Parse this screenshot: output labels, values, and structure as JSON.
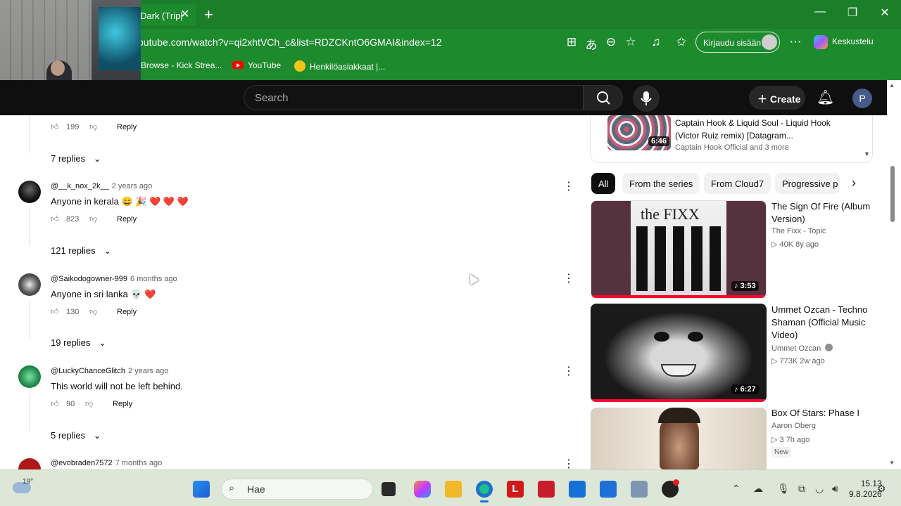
{
  "browser": {
    "tab_title": "Dark (Trip|",
    "url": "outube.com/watch?v=qi2xhtVCh_c&list=RDZCKntO6GMAI&index=12",
    "login_label": "Kirjaudu sisään",
    "copilot_label": "Keskustelu",
    "bookmarks": [
      {
        "label": "Browse - Kick Strea..."
      },
      {
        "label": "YouTube"
      },
      {
        "label": "Henkilöasiakkaat |..."
      }
    ]
  },
  "youtube": {
    "search_placeholder": "Search",
    "create_label": "Create",
    "profile_initial": "P"
  },
  "comments": {
    "first_actions": {
      "likes": "199",
      "reply": "Reply"
    },
    "first_replies": "7 replies",
    "items": [
      {
        "author": "@__k_nox_2k__",
        "time": "2 years ago",
        "text": "Anyone in kerala 😄 🎉 ❤️ ❤️ ❤️",
        "likes": "823",
        "reply": "Reply",
        "replies": "121 replies"
      },
      {
        "author": "@Saikodogowner-999",
        "time": "6 months ago",
        "text": "Anyone in sri lanka 💀 ❤️",
        "likes": "130",
        "reply": "Reply",
        "replies": "19 replies"
      },
      {
        "author": "@LuckyChanceGlitch",
        "time": "2 years ago",
        "text": "This world will not be left behind.",
        "likes": "90",
        "reply": "Reply",
        "replies": "5 replies"
      },
      {
        "author": "@evobraden7572",
        "time": "7 months ago"
      }
    ]
  },
  "playlist_item": {
    "title": "Captain Hook & Liquid Soul - Liquid Hook (Victor Ruiz remix) [Datagram...",
    "channel": "Captain Hook Official and 3 more",
    "duration": "6:46"
  },
  "chips": [
    "All",
    "From the series",
    "From Cloud7",
    "Progressive p"
  ],
  "recommendations": [
    {
      "title": "The Sign Of Fire (Album Version)",
      "channel": "The Fixx - Topic",
      "meta": "40K  8y ago",
      "duration": "3:53",
      "thumb_text": "the FIXX"
    },
    {
      "title": "Ummet Ozcan - Techno Shaman (Official Music Video)",
      "channel": "Ummet Ozcan",
      "meta": "773K  2w ago",
      "duration": "6:27"
    },
    {
      "title": "Box Of Stars: Phase I",
      "channel": "Aaron Oberg",
      "meta": "3  7h ago",
      "badge": "New"
    }
  ],
  "taskbar": {
    "weather": "19°",
    "search_label": "Hae",
    "time": "15.13",
    "date": "9.8.2026"
  }
}
